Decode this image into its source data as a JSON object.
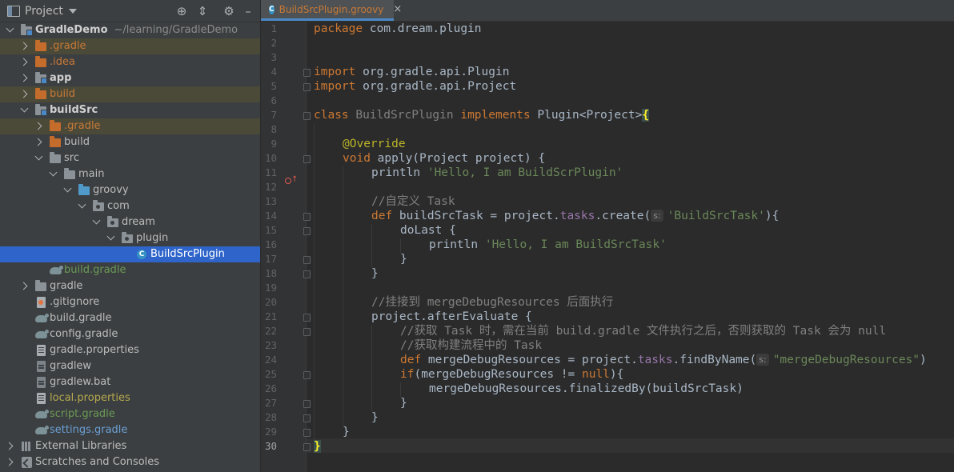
{
  "project_panel": {
    "title": "Project",
    "toolbar_icons": [
      "locate-icon",
      "collapse-all-icon",
      "gear-icon",
      "hide-icon"
    ],
    "tree": [
      {
        "label": "GradleDemo",
        "path": "~/learning/GradleDemo",
        "icon": "module-folder-icon",
        "expanded": true
      },
      {
        "label": ".gradle",
        "icon": "folder-icon",
        "excluded": true
      },
      {
        "label": ".idea",
        "icon": "folder-icon",
        "excluded": true
      },
      {
        "label": "app",
        "icon": "module-folder-icon"
      },
      {
        "label": "build",
        "icon": "folder-icon",
        "excluded": true
      },
      {
        "label": "buildSrc",
        "icon": "module-folder-icon",
        "expanded": true
      },
      {
        "label": ".gradle",
        "icon": "folder-icon",
        "excluded": true
      },
      {
        "label": "build",
        "icon": "folder-icon"
      },
      {
        "label": "src",
        "icon": "folder-icon",
        "expanded": true
      },
      {
        "label": "main",
        "icon": "folder-icon",
        "expanded": true
      },
      {
        "label": "groovy",
        "icon": "source-folder-icon",
        "expanded": true
      },
      {
        "label": "com",
        "icon": "package-icon",
        "expanded": true
      },
      {
        "label": "dream",
        "icon": "package-icon",
        "expanded": true
      },
      {
        "label": "plugin",
        "icon": "package-icon",
        "expanded": true
      },
      {
        "label": "BuildSrcPlugin",
        "icon": "groovy-class-icon",
        "selected": true
      },
      {
        "label": "build.gradle",
        "icon": "gradle-icon"
      },
      {
        "label": "gradle",
        "icon": "folder-icon"
      },
      {
        "label": ".gitignore",
        "icon": "gitignore-icon"
      },
      {
        "label": "build.gradle",
        "icon": "gradle-icon"
      },
      {
        "label": "config.gradle",
        "icon": "gradle-icon"
      },
      {
        "label": "gradle.properties",
        "icon": "properties-icon"
      },
      {
        "label": "gradlew",
        "icon": "script-file-icon"
      },
      {
        "label": "gradlew.bat",
        "icon": "script-file-icon"
      },
      {
        "label": "local.properties",
        "icon": "properties-icon"
      },
      {
        "label": "script.gradle",
        "icon": "gradle-icon"
      },
      {
        "label": "settings.gradle",
        "icon": "gradle-icon"
      },
      {
        "label": "External Libraries",
        "icon": "libraries-icon"
      },
      {
        "label": "Scratches and Consoles",
        "icon": "scratches-icon"
      }
    ]
  },
  "editor": {
    "tab_label": "BuildSrcPlugin.groovy",
    "tab_icon": "groovy-class-icon",
    "current_line": 30,
    "line_numbers": [
      "1",
      "2",
      "3",
      "4",
      "5",
      "6",
      "7",
      "8",
      "9",
      "10",
      "11",
      "12",
      "13",
      "14",
      "15",
      "16",
      "17",
      "18",
      "19",
      "20",
      "21",
      "22",
      "23",
      "24",
      "25",
      "26",
      "27",
      "28",
      "29",
      "30"
    ],
    "code": {
      "l1_kw": "package",
      "l1_rest": " com.dream.plugin",
      "l4_kw": "import",
      "l4_rest": " org.gradle.api.Plugin",
      "l5_kw": "import",
      "l5_rest": " org.gradle.api.Project",
      "l7_kw1": "class",
      "l7_name": " BuildSrcPlugin ",
      "l7_kw2": "implements",
      "l7_rest": " Plugin<Project>",
      "l7_brace": "{",
      "l9": "@Override",
      "l10_kw": "void",
      "l10_rest": " apply(Project project) {",
      "l11_fn": "println ",
      "l11_str": "'Hello, I am BuildScrPlugin'",
      "l13": "//自定义 Task",
      "l14_kw": "def",
      "l14_a": " buildSrcTask = project.",
      "l14_fld": "tasks",
      "l14_b": ".create(",
      "l14_hint": "s:",
      "l14_str": "'BuildSrcTask'",
      "l14_c": "){",
      "l15": "doLast {",
      "l16_fn": "println ",
      "l16_str": "'Hello, I am BuildSrcTask'",
      "l17": "}",
      "l18": "}",
      "l20": "//挂接到 mergeDebugResources 后面执行",
      "l21": "project.afterEvaluate {",
      "l22": "//获取 Task 时，需在当前 build.gradle 文件执行之后，否则获取的 Task 会为 null",
      "l23": "//获取构建流程中的 Task",
      "l24_kw": "def",
      "l24_a": " mergeDebugResources = project.",
      "l24_fld": "tasks",
      "l24_b": ".findByName(",
      "l24_hint": "s:",
      "l24_str": "\"mergeDebugResources\"",
      "l24_c": ")",
      "l25_kw1": "if",
      "l25_a": "(mergeDebugResources != ",
      "l25_kw2": "null",
      "l25_b": "){",
      "l26": "mergeDebugResources.finalizedBy(buildSrcTask)",
      "l27": "}",
      "l28": "}",
      "l29": "}",
      "l30": "}"
    }
  },
  "colors": {
    "keyword": "#cc7832",
    "string": "#6a8759",
    "comment": "#808080",
    "annotation": "#bbb529",
    "field": "#9876aa",
    "selection": "#2f65ca"
  }
}
